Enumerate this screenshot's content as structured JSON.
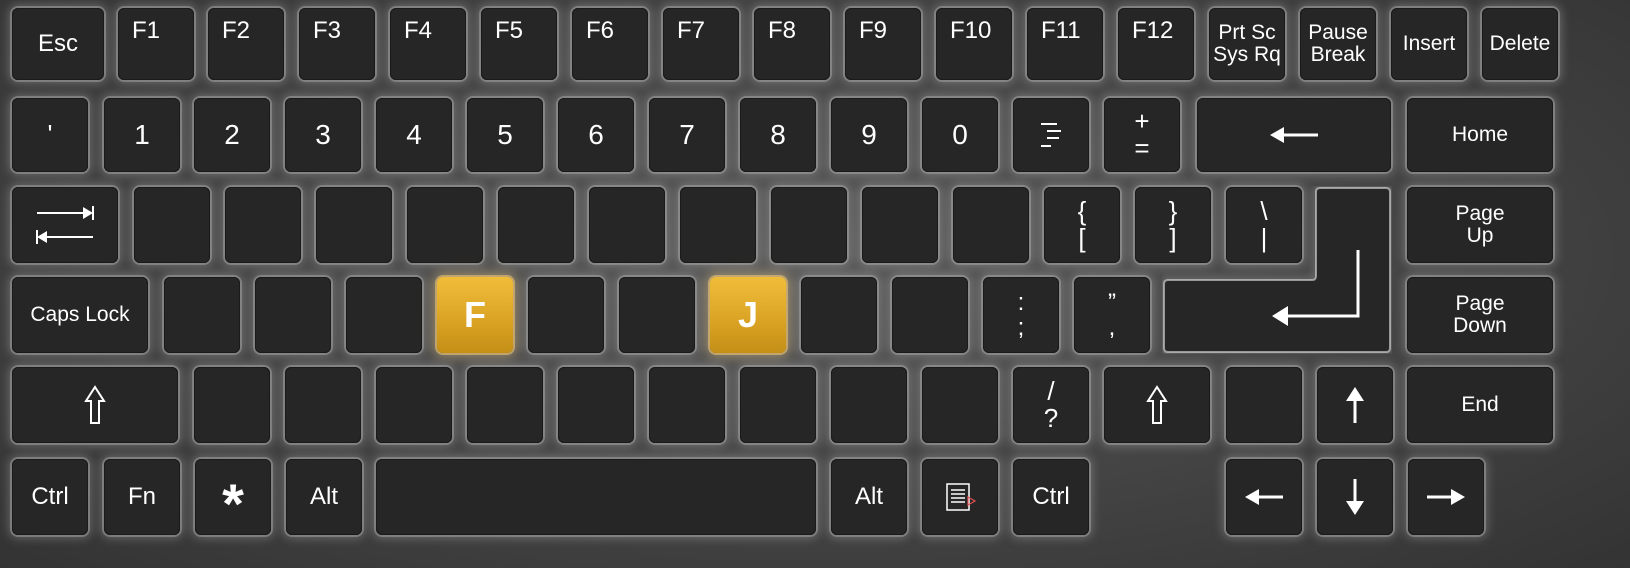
{
  "row_function": [
    "Esc",
    "F1",
    "F2",
    "F3",
    "F4",
    "F5",
    "F6",
    "F7",
    "F8",
    "F9",
    "F10",
    "F11",
    "F12"
  ],
  "prtsc": [
    "Prt Sc",
    "Sys Rq"
  ],
  "pause": [
    "Pause",
    "Break"
  ],
  "insert": "Insert",
  "delete": "Delete",
  "row_numbers": [
    "'",
    "1",
    "2",
    "3",
    "4",
    "5",
    "6",
    "7",
    "8",
    "9",
    "0"
  ],
  "plus": [
    "+",
    "="
  ],
  "home": "Home",
  "brackets": {
    "open": [
      "{",
      "["
    ],
    "close": [
      "}",
      "]"
    ],
    "pipe": [
      "\\",
      "|"
    ]
  },
  "pageup": [
    "Page",
    "Up"
  ],
  "capslock": "Caps Lock",
  "home_keys": {
    "f": "F",
    "j": "J"
  },
  "semicolon": [
    ":",
    ";"
  ],
  "quote": [
    "”",
    ","
  ],
  "pagedown": [
    "Page",
    "Down"
  ],
  "slash": [
    "/",
    "?"
  ],
  "end": "End",
  "bottom": {
    "ctrl_left": "Ctrl",
    "fn": "Fn",
    "star": "*",
    "alt_left": "Alt",
    "alt_right": "Alt",
    "ctrl_right": "Ctrl"
  },
  "colors": {
    "key": "#262626",
    "highlight": "#e0a92a",
    "text": "#ffffff"
  }
}
